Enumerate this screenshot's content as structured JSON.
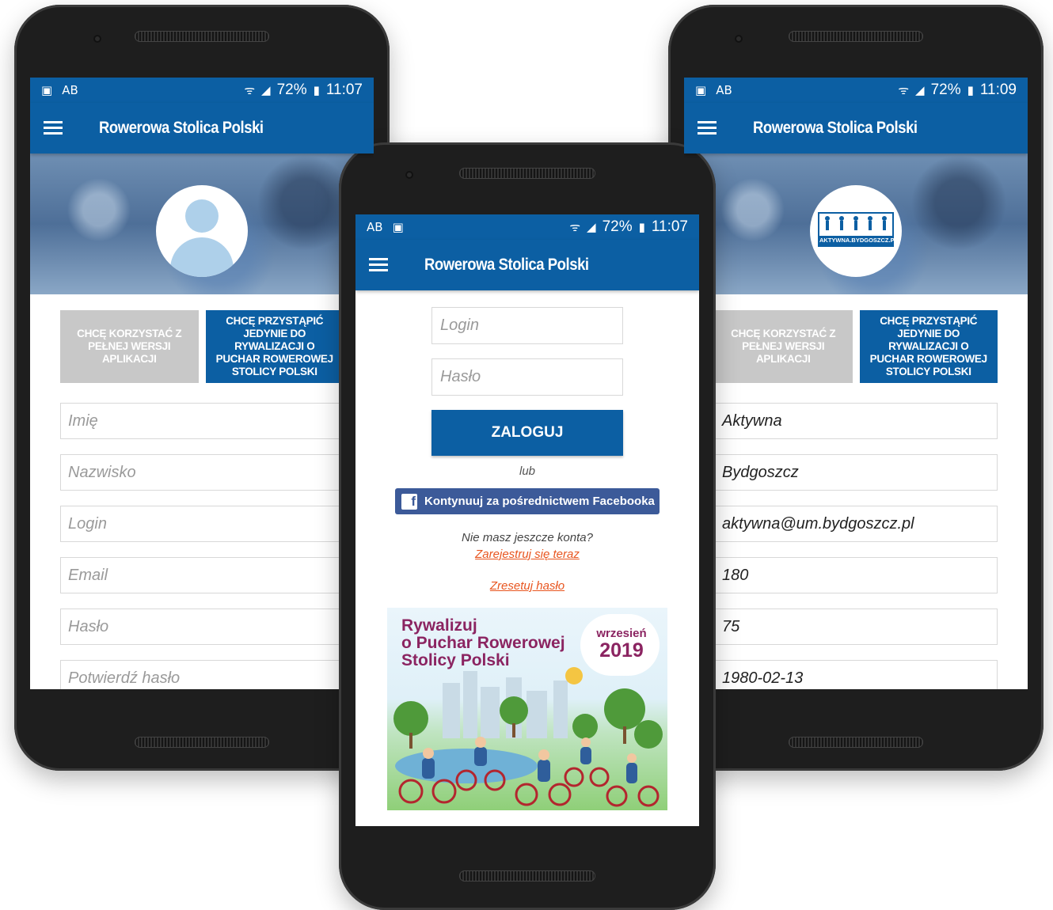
{
  "status_left": {
    "battery": "72%",
    "time": "11:07"
  },
  "status_center": {
    "battery": "72%",
    "time": "11:07"
  },
  "status_right": {
    "battery": "72%",
    "time": "11:09"
  },
  "app_title": "Rowerowa Stolica Polski",
  "icons": {
    "menu": "hamburger-icon",
    "wifi": "wifi-icon",
    "signal": "signal-icon",
    "battery": "battery-icon",
    "facebook": "facebook-icon",
    "avatar": "avatar-icon"
  },
  "mode_buttons": {
    "full": "CHCĘ KORZYSTAĆ Z PEŁNEJ WERSJI APLIKACJI",
    "compete": "CHCĘ PRZYSTĄPIĆ JEDYNIE DO RYWALIZACJI O PUCHAR ROWEROWEJ STOLICY POLSKI"
  },
  "register_form": {
    "first_name": "Imię",
    "last_name": "Nazwisko",
    "login": "Login",
    "email": "Email",
    "password": "Hasło",
    "confirm_password": "Potwierdź hasło"
  },
  "login": {
    "login_placeholder": "Login",
    "password_placeholder": "Hasło",
    "submit": "ZALOGUJ",
    "or": "lub",
    "facebook": "Kontynuuj za pośrednictwem Facebooka",
    "no_account": "Nie masz jeszcze konta?",
    "register_link": "Zarejestruj się teraz",
    "reset_link": "Zresetuj hasło"
  },
  "banner": {
    "title": "Rywalizuj\no Puchar Rowerowej\nStolicy Polski",
    "month": "wrzesień",
    "year": "2019"
  },
  "profile_form": {
    "first_name": "Aktywna",
    "last_name": "Bydgoszcz",
    "email": "aktywna@um.bydgoszcz.pl",
    "height": "180",
    "weight": "75",
    "birth_date": "1980-02-13"
  },
  "logo_text": "AKTYWNA.BYDGOSZCZ.PL",
  "colors": {
    "brand_blue": "#0c5fa3",
    "link_orange": "#e8551f",
    "facebook_blue": "#3c5a99",
    "gray_button": "#c8c8c8"
  }
}
